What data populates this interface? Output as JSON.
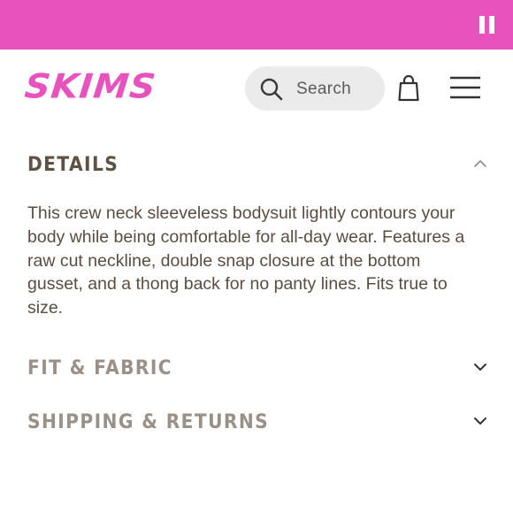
{
  "banner": {
    "color": "#e752bc",
    "pause_icon": "pause-icon"
  },
  "header": {
    "logo_text": "SKIMS",
    "logo_color": "#e752bc",
    "search": {
      "placeholder": "Search",
      "icon": "search-icon"
    },
    "bag_icon": "shopping-bag-icon",
    "menu_icon": "hamburger-menu-icon"
  },
  "sections": [
    {
      "title": "DETAILS",
      "expanded": true,
      "chevron": "chevron-up-icon",
      "body": "This crew neck sleeveless bodysuit lightly contours your body while being comfortable for all-day wear. Features a raw cut neckline, double snap closure at the bottom gusset, and a thong back for no panty lines. Fits true to size."
    },
    {
      "title": "FIT & FABRIC",
      "expanded": false,
      "chevron": "chevron-down-icon"
    },
    {
      "title": "SHIPPING & RETURNS",
      "expanded": false,
      "chevron": "chevron-down-icon"
    }
  ],
  "colors": {
    "active_heading": "#5e5244",
    "inactive_heading": "#9a9088",
    "body_text": "#5a4d40"
  }
}
